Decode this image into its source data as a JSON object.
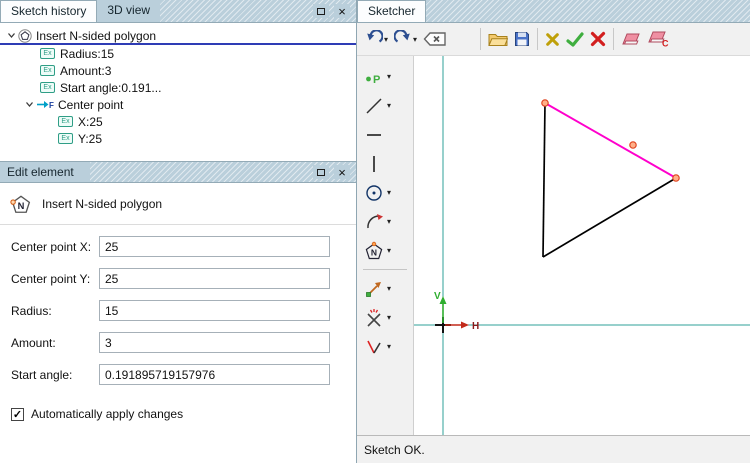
{
  "icons": {
    "close": "×",
    "dropdown": "▾",
    "check": "✓",
    "ex_badge": "Ex",
    "point_letter": "P",
    "polygon_letter": "N",
    "eraser_letter": "C",
    "center_point_letter": "F"
  },
  "left_panel": {
    "tabs": [
      {
        "label": "Sketch history",
        "active": true
      },
      {
        "label": "3D view",
        "active": false
      }
    ],
    "tree": {
      "root_label": "Insert N-sided polygon",
      "items": [
        {
          "label": "Radius:15"
        },
        {
          "label": "Amount:3"
        },
        {
          "label": "Start angle:0.191..."
        },
        {
          "label": "Center point"
        },
        {
          "label": "X:25"
        },
        {
          "label": "Y:25"
        }
      ]
    },
    "edit_panel": {
      "title": "Edit element",
      "heading": "Insert N-sided polygon",
      "fields": [
        {
          "label": "Center point X:",
          "value": "25"
        },
        {
          "label": "Center point Y:",
          "value": "25"
        },
        {
          "label": "Radius:",
          "value": "15"
        },
        {
          "label": "Amount:",
          "value": "3"
        },
        {
          "label": "Start angle:",
          "value": "0.191895719157976"
        }
      ],
      "apply_checkbox": {
        "label": "Automatically apply changes",
        "checked": true
      }
    }
  },
  "sketcher": {
    "tab_label": "Sketcher",
    "status_text": "Sketch OK.",
    "axes": {
      "vertical": "V",
      "horizontal": "H"
    },
    "colors": {
      "axis": "#2fa098",
      "selected_edge": "#ff00cc",
      "edge": "#000000",
      "vertex_fill": "#ffb089",
      "vertex_stroke": "#e04420",
      "v_arrow": "#2fae2f",
      "h_arrow": "#c22a1a"
    }
  }
}
